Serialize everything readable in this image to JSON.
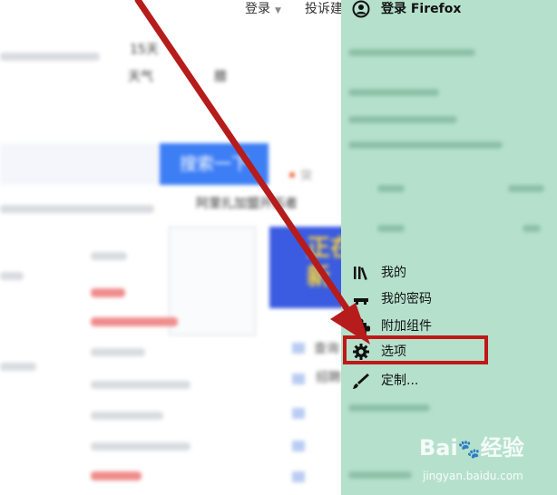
{
  "page": {
    "topbar": {
      "login": "登录",
      "feedback": "投诉建"
    },
    "weather": {
      "temp": "15天",
      "label": "天气",
      "extra": "腊"
    },
    "search": {
      "button_label": "搜索一下",
      "hot_word": "突"
    },
    "news_link": "阿里扎加盟开拓者",
    "ad": {
      "text": "正在\n新"
    },
    "query": {
      "text1": "查询",
      "text2": "招聘"
    }
  },
  "menu": {
    "signin": {
      "label": "登录 Firefox",
      "icon": "account-icon"
    },
    "items": [
      {
        "label": "我的",
        "icon": "library-icon"
      },
      {
        "label": "我的密码",
        "icon": "key-icon"
      },
      {
        "label": "附加组件",
        "icon": "puzzle-icon"
      },
      {
        "label": "选项",
        "icon": "gear-icon"
      },
      {
        "label": "定制...",
        "icon": "brush-icon"
      }
    ],
    "highlight_color": "#c01818",
    "background": "#b5e1cc"
  },
  "annotation": {
    "arrow_color": "#b61c1c"
  },
  "watermark": {
    "logo": "Bai 经验",
    "url": "jingyan.baidu.com"
  }
}
